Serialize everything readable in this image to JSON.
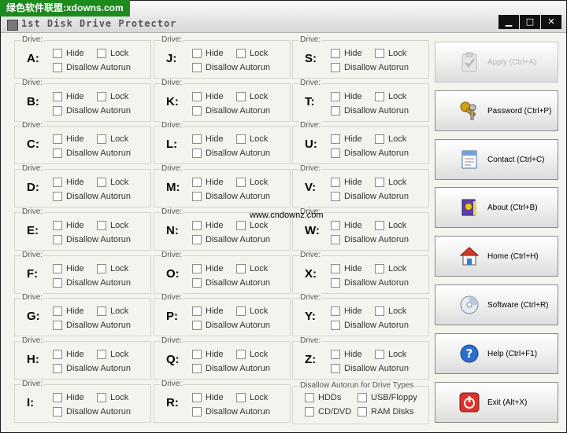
{
  "watermark": "绿色软件联盟:xdowns.com",
  "window": {
    "title": "1st Disk Drive Protector",
    "buttons": {
      "minimize": "▁",
      "maximize": "□",
      "close": "✕"
    }
  },
  "labels": {
    "drive": "Drive:",
    "hide": "Hide",
    "lock": "Lock",
    "disallow_autorun": "Disallow Autorun"
  },
  "drives": [
    {
      "letter": "A:"
    },
    {
      "letter": "B:"
    },
    {
      "letter": "C:"
    },
    {
      "letter": "D:"
    },
    {
      "letter": "E:"
    },
    {
      "letter": "F:"
    },
    {
      "letter": "G:"
    },
    {
      "letter": "H:"
    },
    {
      "letter": "I:"
    },
    {
      "letter": "J:"
    },
    {
      "letter": "K:"
    },
    {
      "letter": "L:"
    },
    {
      "letter": "M:"
    },
    {
      "letter": "N:"
    },
    {
      "letter": "O:"
    },
    {
      "letter": "P:"
    },
    {
      "letter": "Q:"
    },
    {
      "letter": "R:"
    },
    {
      "letter": "S:"
    },
    {
      "letter": "T:"
    },
    {
      "letter": "U:"
    },
    {
      "letter": "V:"
    },
    {
      "letter": "W:"
    },
    {
      "letter": "X:"
    },
    {
      "letter": "Y:"
    },
    {
      "letter": "Z:"
    }
  ],
  "autorun_types": {
    "title": "Disallow Autorun for Drive Types",
    "hdds": "HDDs",
    "usb_floppy": "USB/Floppy",
    "cd_dvd": "CD/DVD",
    "ram_disks": "RAM Disks"
  },
  "actions": [
    {
      "label": "Apply (Ctrl+A)",
      "icon": "clipboard-check-icon",
      "enabled": false
    },
    {
      "label": "Password (Ctrl+P)",
      "icon": "keys-icon",
      "enabled": true
    },
    {
      "label": "Contact (Ctrl+C)",
      "icon": "contact-card-icon",
      "enabled": true
    },
    {
      "label": "About (Ctrl+B)",
      "icon": "book-icon",
      "enabled": true
    },
    {
      "label": "Home (Ctrl+H)",
      "icon": "home-icon",
      "enabled": true
    },
    {
      "label": "Software (Ctrl+R)",
      "icon": "software-cd-icon",
      "enabled": true
    },
    {
      "label": "Help (Ctrl+F1)",
      "icon": "help-icon",
      "enabled": true
    },
    {
      "label": "Exit (Alt+X)",
      "icon": "power-icon",
      "enabled": true
    }
  ],
  "overlay_text": "www.cndownz.com"
}
